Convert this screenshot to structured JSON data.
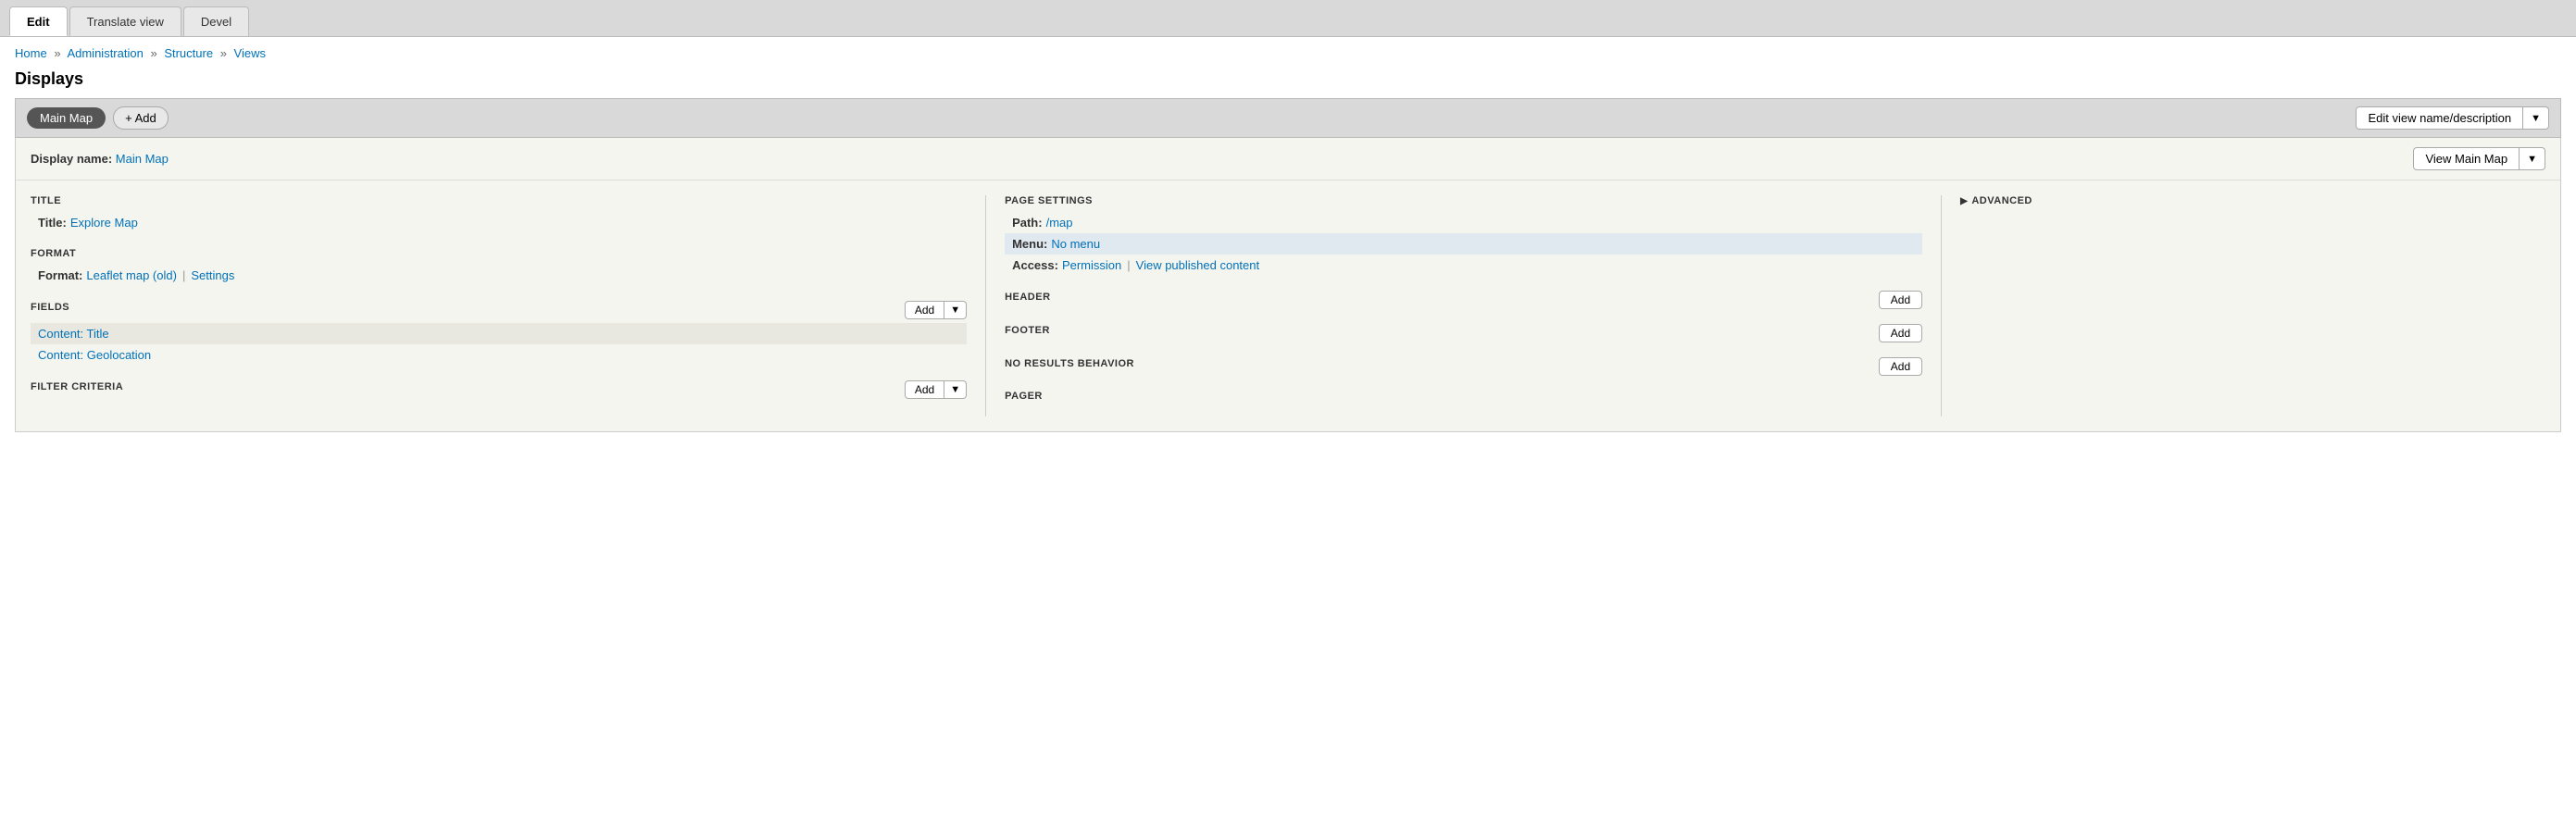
{
  "tabs": [
    {
      "id": "edit",
      "label": "Edit",
      "active": true
    },
    {
      "id": "translate-view",
      "label": "Translate view",
      "active": false
    },
    {
      "id": "devel",
      "label": "Devel",
      "active": false
    }
  ],
  "breadcrumb": {
    "items": [
      {
        "label": "Home",
        "href": "#"
      },
      {
        "label": "Administration",
        "href": "#"
      },
      {
        "label": "Structure",
        "href": "#"
      },
      {
        "label": "Views",
        "href": "#"
      }
    ]
  },
  "displays_title": "Displays",
  "toolbar": {
    "main_map_label": "Main Map",
    "add_label": "+ Add",
    "edit_view_label": "Edit view name/description",
    "dropdown_arrow": "▼"
  },
  "display_name": {
    "label_text": "Display name:",
    "value": "Main Map",
    "view_button": "View Main Map",
    "dropdown_arrow": "▼"
  },
  "title_section": {
    "header": "TITLE",
    "label": "Title:",
    "value": "Explore Map"
  },
  "format_section": {
    "header": "FORMAT",
    "label": "Format:",
    "format_link": "Leaflet map (old)",
    "sep": "|",
    "settings_link": "Settings"
  },
  "fields_section": {
    "header": "FIELDS",
    "add_label": "Add",
    "dropdown_arrow": "▼",
    "items": [
      {
        "label": "Content: Title"
      },
      {
        "label": "Content: Geolocation"
      }
    ]
  },
  "filter_criteria_section": {
    "header": "FILTER CRITERIA",
    "add_label": "Add",
    "dropdown_arrow": "▼"
  },
  "page_settings_section": {
    "header": "PAGE SETTINGS",
    "path_label": "Path:",
    "path_value": "/map",
    "menu_label": "Menu:",
    "menu_value": "No menu",
    "access_label": "Access:",
    "permission_link": "Permission",
    "sep": "|",
    "view_published_link": "View published content"
  },
  "header_section": {
    "header": "HEADER",
    "add_label": "Add"
  },
  "footer_section": {
    "header": "FOOTER",
    "add_label": "Add"
  },
  "no_results_section": {
    "header": "NO RESULTS BEHAVIOR",
    "add_label": "Add"
  },
  "pager_section": {
    "header": "PAGER"
  },
  "advanced_section": {
    "header": "ADVANCED",
    "triangle": "▶"
  }
}
